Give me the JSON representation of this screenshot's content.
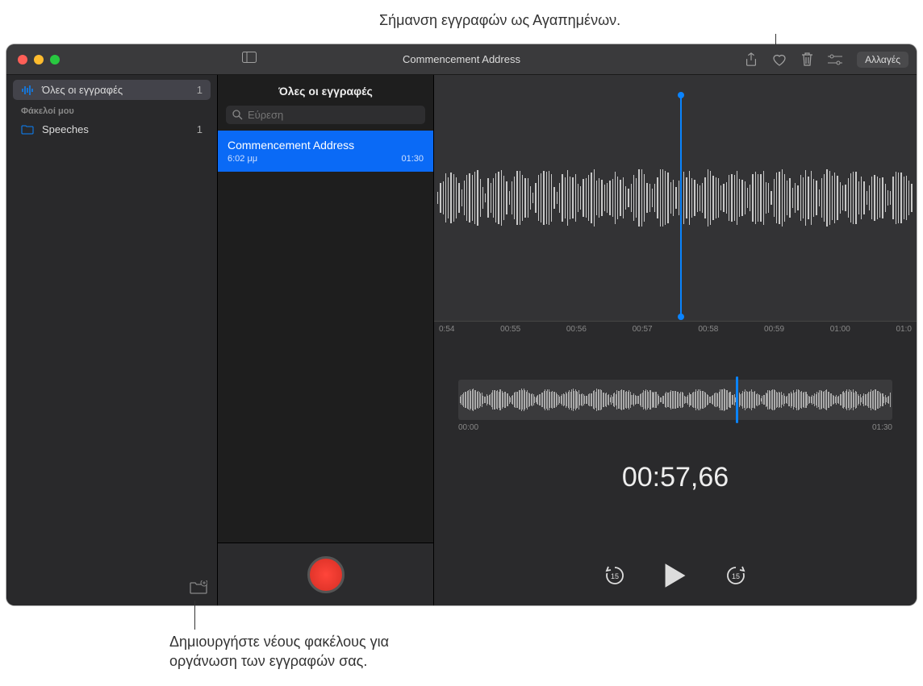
{
  "callouts": {
    "top": "Σήμανση εγγραφών ως Αγαπημένων.",
    "bottom_l1": "Δημιουργήστε νέους φακέλους για",
    "bottom_l2": "οργάνωση των εγγραφών σας."
  },
  "titlebar": {
    "title": "Commencement Address",
    "edit_label": "Αλλαγές"
  },
  "sidebar": {
    "all_label": "Όλες οι εγγραφές",
    "all_count": "1",
    "folders_header": "Φάκελοί μου",
    "folders": [
      {
        "name": "Speeches",
        "count": "1"
      }
    ]
  },
  "list": {
    "header": "Όλες οι εγγραφές",
    "search_placeholder": "Εύρεση",
    "items": [
      {
        "title": "Commencement Address",
        "time": "6:02 μμ",
        "duration": "01:30"
      }
    ]
  },
  "detail": {
    "ticks": [
      "0:54",
      "00:55",
      "00:56",
      "00:57",
      "00:58",
      "00:59",
      "01:00",
      "01:0"
    ],
    "overview_start": "00:00",
    "overview_end": "01:30",
    "current_time": "00:57,66",
    "playhead_percent": 51,
    "overview_playhead_percent": 64
  },
  "colors": {
    "accent": "#0a84ff",
    "record": "#ff453a"
  }
}
